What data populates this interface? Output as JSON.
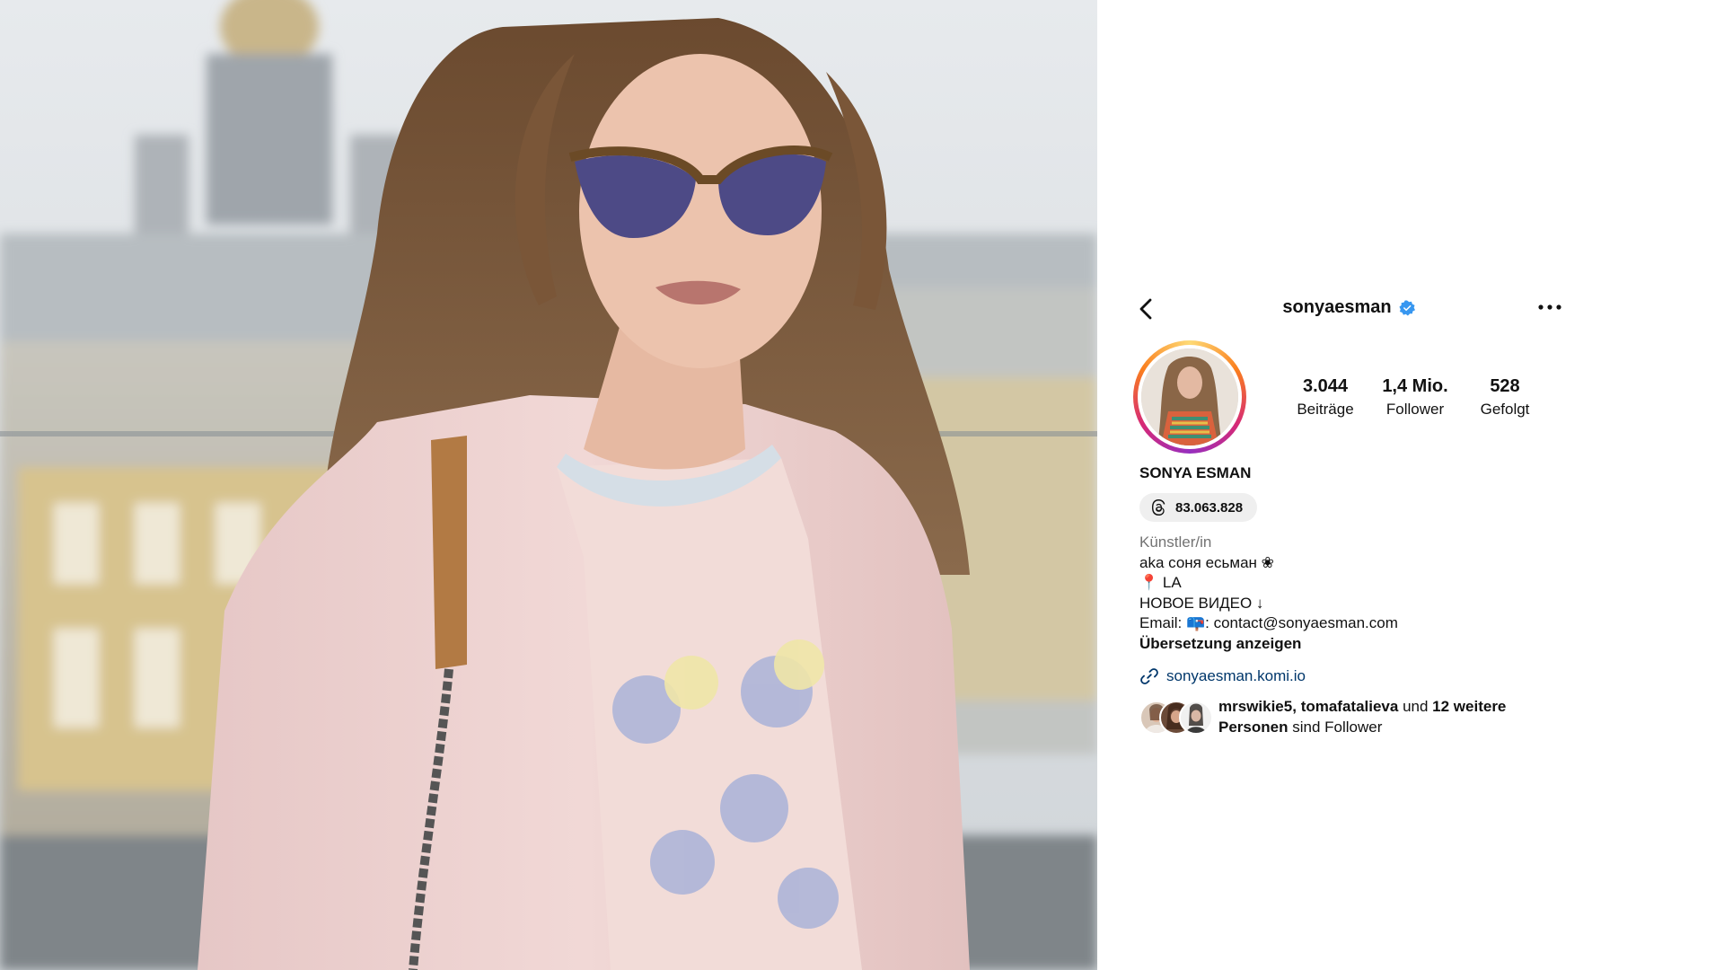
{
  "header": {
    "username": "sonyaesman"
  },
  "stats": {
    "posts_value": "3.044",
    "posts_label": "Beiträge",
    "followers_value": "1,4 Mio.",
    "followers_label": "Follower",
    "following_value": "528",
    "following_label": "Gefolgt"
  },
  "profile": {
    "display_name": "SONYA ESMAN",
    "threads_count": "83.063.828"
  },
  "bio": {
    "category": "Künstler/in",
    "line1": "aka соня есьман ❀",
    "line2": "📍 LA",
    "line3": "НОВОЕ ВИДЕО ↓",
    "line4": "Email: 📪: contact@sonyaesman.com",
    "translate": "Übersetzung anzeigen"
  },
  "link": {
    "url_text": "sonyaesman.komi.io"
  },
  "followed_by": {
    "user1": "mrswikie5",
    "sep1": ", ",
    "user2": "tomafatalieva",
    "and": " und ",
    "more": "12 weitere Personen",
    "suffix": " sind Follower"
  },
  "icons": {
    "back": "chevron-left-icon",
    "verified": "verified-badge-icon",
    "more": "more-options-icon",
    "threads": "threads-icon",
    "link": "link-icon"
  },
  "colors": {
    "verified_blue": "#3897f0",
    "link_blue": "#00376b",
    "category_gray": "#737373"
  }
}
